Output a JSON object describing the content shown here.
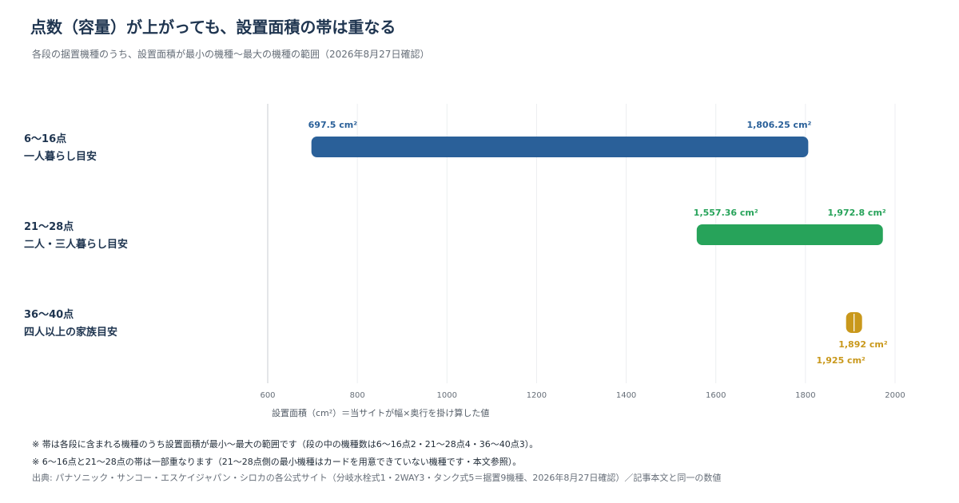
{
  "header": {
    "title": "点数（容量）が上がっても、設置面積の帯は重なる",
    "subtitle": "各段の据置機種のうち、設置面積が最小の機種〜最大の機種の範囲（2026年8月27日確認）"
  },
  "chart_data": {
    "type": "range-bar",
    "xlabel": "設置面積（cm²）＝当サイトが幅×奥行を掛け算した値",
    "xlim": [
      600,
      2000
    ],
    "xticks": [
      600,
      800,
      1000,
      1200,
      1400,
      1600,
      1800,
      2000
    ],
    "grid": true,
    "rows": [
      {
        "label_line1": "6〜16点",
        "label_line2": "一人暮らし目安",
        "min": 697.5,
        "max": 1806.25,
        "min_label": "697.5 cm²",
        "max_label": "1,806.25 cm²",
        "color": "#2a6099"
      },
      {
        "label_line1": "21〜28点",
        "label_line2": "二人・三人暮らし目安",
        "min": 1557.36,
        "max": 1972.8,
        "min_label": "1,557.36 cm²",
        "max_label": "1,972.8 cm²",
        "color": "#27a35a"
      },
      {
        "label_line1": "36〜40点",
        "label_line2": "四人以上の家族目安",
        "min": 1892,
        "max": 1925,
        "min_label": "1,892 cm²",
        "max_label": "1,925 cm²",
        "color": "#c9981b"
      }
    ]
  },
  "footer": {
    "note1": "※ 帯は各段に含まれる機種のうち設置面積が最小〜最大の範囲です（段の中の機種数は6〜16点2・21〜28点4・36〜40点3）。",
    "note2": "※ 6〜16点と21〜28点の帯は一部重なります（21〜28点側の最小機種はカードを用意できていない機種です・本文参照）。",
    "source": "出典: パナソニック・サンコー・エスケイジャパン・シロカの各公式サイト（分岐水栓式1・2WAY3・タンク式5＝据置9機種、2026年8月27日確認）／記事本文と同一の数値"
  }
}
